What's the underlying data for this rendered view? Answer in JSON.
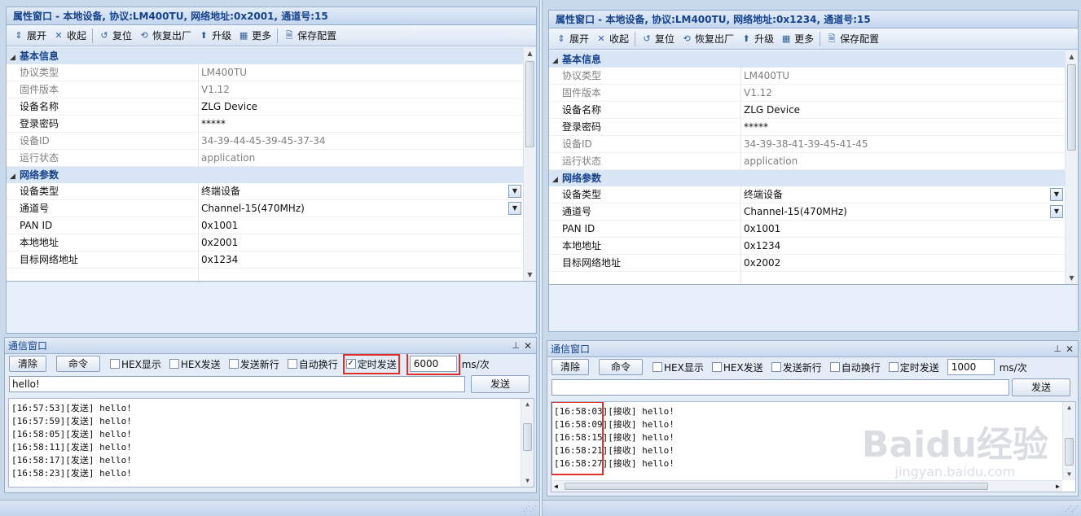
{
  "left": {
    "title": "属性窗口 - 本地设备, 协议:LM400TU, 网络地址:0x2001, 通道号:15",
    "toolbar": [
      "展开",
      "收起",
      "复位",
      "恢复出厂",
      "升级",
      "更多",
      "保存配置"
    ],
    "basic_title": "基本信息",
    "basic": [
      {
        "k": "协议类型",
        "v": "LM400TU",
        "ro": true
      },
      {
        "k": "固件版本",
        "v": "V1.12",
        "ro": true
      },
      {
        "k": "设备名称",
        "v": "ZLG Device",
        "ro": false
      },
      {
        "k": "登录密码",
        "v": "*****",
        "ro": false
      },
      {
        "k": "设备ID",
        "v": "34-39-44-45-39-45-37-34",
        "ro": true
      },
      {
        "k": "运行状态",
        "v": "application",
        "ro": true
      }
    ],
    "net_title": "网络参数",
    "net": [
      {
        "k": "设备类型",
        "v": "终端设备",
        "dd": true
      },
      {
        "k": "通道号",
        "v": "Channel-15(470MHz)",
        "dd": true
      },
      {
        "k": "PAN ID",
        "v": "0x1001",
        "dd": false
      },
      {
        "k": "本地地址",
        "v": "0x2001",
        "dd": false
      },
      {
        "k": "目标网络地址",
        "v": "0x1234",
        "dd": false
      }
    ],
    "comm": {
      "title": "通信窗口",
      "clear": "清除",
      "cmd": "命令",
      "hex_show": "HEX显示",
      "hex_send": "HEX发送",
      "send_newline": "发送新行",
      "auto_wrap": "自动换行",
      "timed_send": "定时发送",
      "timed_checked": true,
      "interval": "6000",
      "unit": "ms/次",
      "input": "hello!",
      "send": "发送",
      "log": [
        "[16:57:53][发送] hello!",
        "[16:57:59][发送] hello!",
        "[16:58:05][发送] hello!",
        "[16:58:11][发送] hello!",
        "[16:58:17][发送] hello!",
        "[16:58:23][发送] hello!"
      ]
    }
  },
  "right": {
    "title": "属性窗口 - 本地设备, 协议:LM400TU, 网络地址:0x1234, 通道号:15",
    "toolbar": [
      "展开",
      "收起",
      "复位",
      "恢复出厂",
      "升级",
      "更多",
      "保存配置"
    ],
    "basic_title": "基本信息",
    "basic": [
      {
        "k": "协议类型",
        "v": "LM400TU",
        "ro": true
      },
      {
        "k": "固件版本",
        "v": "V1.12",
        "ro": true
      },
      {
        "k": "设备名称",
        "v": "ZLG Device",
        "ro": false
      },
      {
        "k": "登录密码",
        "v": "*****",
        "ro": false
      },
      {
        "k": "设备ID",
        "v": "34-39-38-41-39-45-41-45",
        "ro": true
      },
      {
        "k": "运行状态",
        "v": "application",
        "ro": true
      }
    ],
    "net_title": "网络参数",
    "net": [
      {
        "k": "设备类型",
        "v": "终端设备",
        "dd": true
      },
      {
        "k": "通道号",
        "v": "Channel-15(470MHz)",
        "dd": true
      },
      {
        "k": "PAN ID",
        "v": "0x1001",
        "dd": false
      },
      {
        "k": "本地地址",
        "v": "0x1234",
        "dd": false
      },
      {
        "k": "目标网络地址",
        "v": "0x2002",
        "dd": false
      }
    ],
    "comm": {
      "title": "通信窗口",
      "clear": "清除",
      "cmd": "命令",
      "hex_show": "HEX显示",
      "hex_send": "HEX发送",
      "send_newline": "发送新行",
      "auto_wrap": "自动换行",
      "timed_send": "定时发送",
      "timed_checked": false,
      "interval": "1000",
      "unit": "ms/次",
      "input": "",
      "send": "发送",
      "log": [
        "[16:58:03][接收] hello!",
        "[16:58:09][接收] hello!",
        "[16:58:15][接收] hello!",
        "[16:58:21][接收] hello!",
        "[16:58:27][接收] hello!"
      ]
    }
  },
  "watermark": {
    "big": "Baidu经验",
    "small": "jingyan.baidu.com"
  }
}
